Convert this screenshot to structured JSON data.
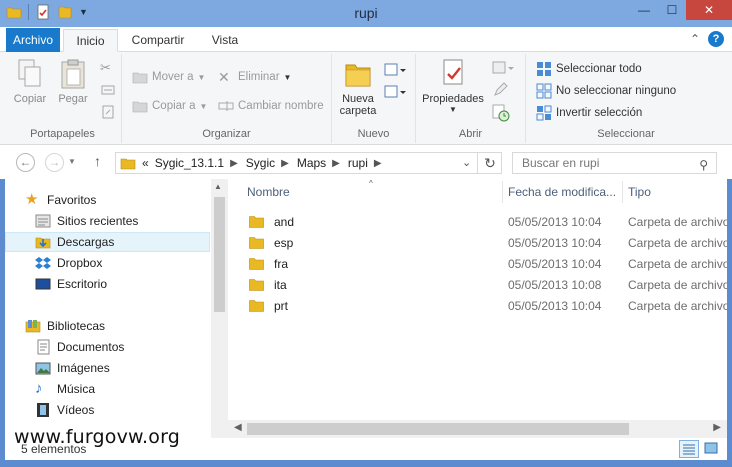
{
  "window": {
    "title": "rupi",
    "controls": {
      "minimize": "—",
      "maximize": "☐",
      "close": "✕"
    }
  },
  "ribbon_tabs": [
    "Archivo",
    "Inicio",
    "Compartir",
    "Vista"
  ],
  "ribbon": {
    "portapapeles": {
      "label": "Portapapeles",
      "copy": "Copiar",
      "paste": "Pegar"
    },
    "organizar": {
      "label": "Organizar",
      "move_to": "Mover a",
      "copy_to": "Copiar a",
      "delete": "Eliminar",
      "rename": "Cambiar nombre"
    },
    "nuevo": {
      "label": "Nuevo",
      "new_folder_line1": "Nueva",
      "new_folder_line2": "carpeta"
    },
    "abrir": {
      "label": "Abrir",
      "properties": "Propiedades"
    },
    "seleccionar": {
      "label": "Seleccionar",
      "select_all": "Seleccionar todo",
      "select_none": "No seleccionar ninguno",
      "invert": "Invertir selección"
    }
  },
  "address": {
    "overflow": "«",
    "crumbs": [
      "Sygic_13.1.1",
      "Sygic",
      "Maps",
      "rupi"
    ]
  },
  "search": {
    "placeholder": "Buscar en rupi"
  },
  "nav_pane": {
    "favorites": "Favoritos",
    "favorite_items": [
      "Sitios recientes",
      "Descargas",
      "Dropbox",
      "Escritorio"
    ],
    "libraries": "Bibliotecas",
    "library_items": [
      "Documentos",
      "Imágenes",
      "Música",
      "Vídeos"
    ],
    "selected": "Descargas"
  },
  "columns": {
    "name": "Nombre",
    "date": "Fecha de modifica...",
    "type": "Tipo"
  },
  "files": [
    {
      "name": "and",
      "date": "05/05/2013 10:04",
      "type": "Carpeta de archivos"
    },
    {
      "name": "esp",
      "date": "05/05/2013 10:04",
      "type": "Carpeta de archivos"
    },
    {
      "name": "fra",
      "date": "05/05/2013 10:04",
      "type": "Carpeta de archivos"
    },
    {
      "name": "ita",
      "date": "05/05/2013 10:08",
      "type": "Carpeta de archivos"
    },
    {
      "name": "prt",
      "date": "05/05/2013 10:04",
      "type": "Carpeta de archivos"
    }
  ],
  "status": {
    "count": "5 elementos"
  },
  "watermark": "www.furgovw.org",
  "colors": {
    "title_bar": "#7ea8e0",
    "file_tab": "#1979ca",
    "close": "#c7463e",
    "folder": "#e8b923"
  }
}
